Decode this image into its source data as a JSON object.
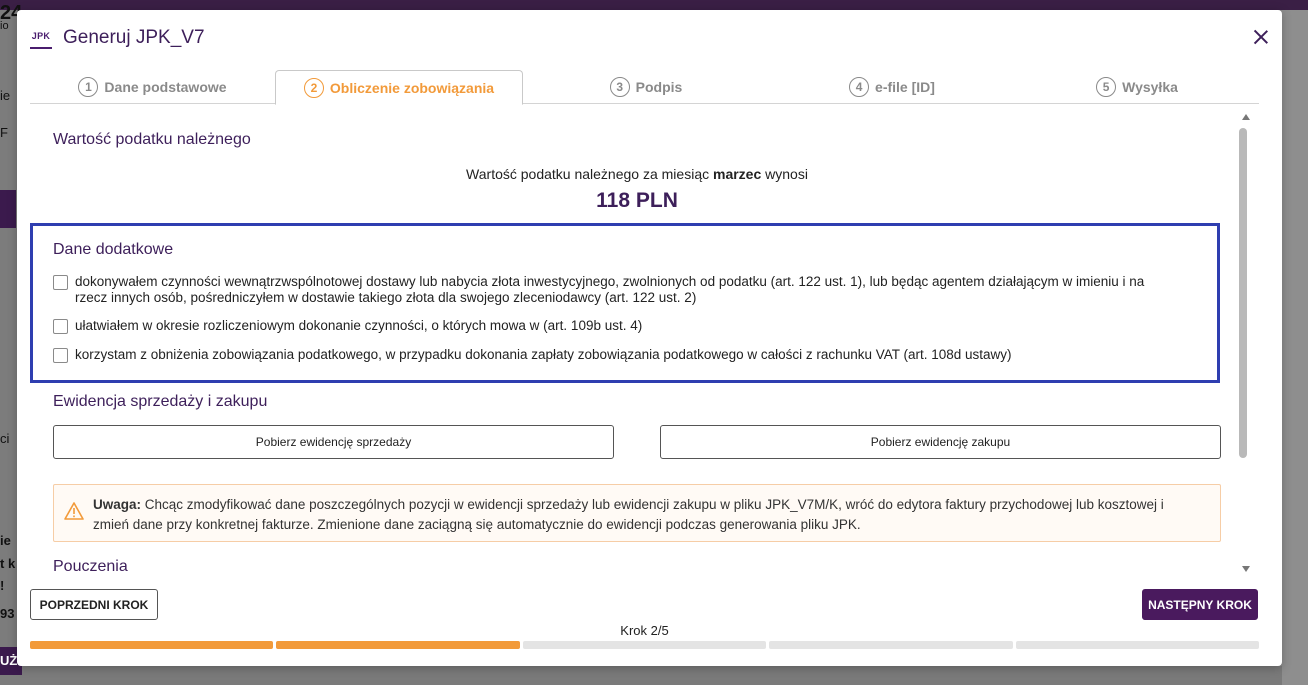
{
  "background": {
    "fragments": [
      "24",
      "io",
      "ie",
      "F",
      "ci",
      "ie",
      "t k",
      "!",
      "93",
      "UŻ"
    ]
  },
  "modal": {
    "icon_label": "JPK",
    "title": "Generuj JPK_V7",
    "close_icon": "close-icon"
  },
  "tabs": [
    {
      "num": "1",
      "label": "Dane podstawowe"
    },
    {
      "num": "2",
      "label": "Obliczenie zobowiązania"
    },
    {
      "num": "3",
      "label": "Podpis"
    },
    {
      "num": "4",
      "label": "e-file [ID]"
    },
    {
      "num": "5",
      "label": "Wysyłka"
    }
  ],
  "active_tab": 2,
  "tax": {
    "section_title": "Wartość podatku należnego",
    "line_prefix": "Wartość podatku należnego za miesiąc ",
    "month": "marzec",
    "line_suffix": " wynosi",
    "amount": "118 PLN"
  },
  "extra": {
    "section_title": "Dane dodatkowe",
    "options": [
      {
        "checked": false,
        "label": "dokonywałem czynności wewnątrzwspólnotowej dostawy lub nabycia złota inwestycyjnego, zwolnionych od podatku (art. 122 ust. 1), lub będąc agentem działającym w imieniu i na rzecz innych osób, pośredniczyłem w dostawie takiego złota dla swojego zleceniodawcy (art. 122 ust. 2)"
      },
      {
        "checked": false,
        "label": "ułatwiałem w okresie rozliczeniowym dokonanie czynności, o których mowa w (art. 109b ust. 4)"
      },
      {
        "checked": false,
        "label": "korzystam z obniżenia zobowiązania podatkowego, w przypadku dokonania zapłaty zobowiązania podatkowego w całości z rachunku VAT (art. 108d ustawy)"
      }
    ]
  },
  "records": {
    "section_title": "Ewidencja sprzedaży i zakupu",
    "sales_button": "Pobierz ewidencję sprzedaży",
    "purchase_button": "Pobierz ewidencję zakupu"
  },
  "warning": {
    "icon": "warning-icon",
    "bold": "Uwaga:",
    "text": " Chcąc zmodyfikować dane poszczególnych pozycji w ewidencji sprzedaży lub ewidencji zakupu w pliku JPK_V7M/K, wróć do edytora faktury przychodowej lub kosztowej i zmień dane przy konkretnej fakturze. Zmienione dane zaciągną się automatycznie do ewidencji podczas generowania pliku JPK."
  },
  "instructions": {
    "section_title": "Pouczenia"
  },
  "footer": {
    "prev_label": "POPRZEDNI KROK",
    "next_label": "NASTĘPNY KROK",
    "step_label": "Krok 2/5",
    "progress_total": 5,
    "progress_done": 2
  },
  "colors": {
    "brand": "#4a1a5e",
    "accent": "#f29a3a",
    "highlight": "#2f3eb0",
    "warning_border": "#f6cda6"
  }
}
